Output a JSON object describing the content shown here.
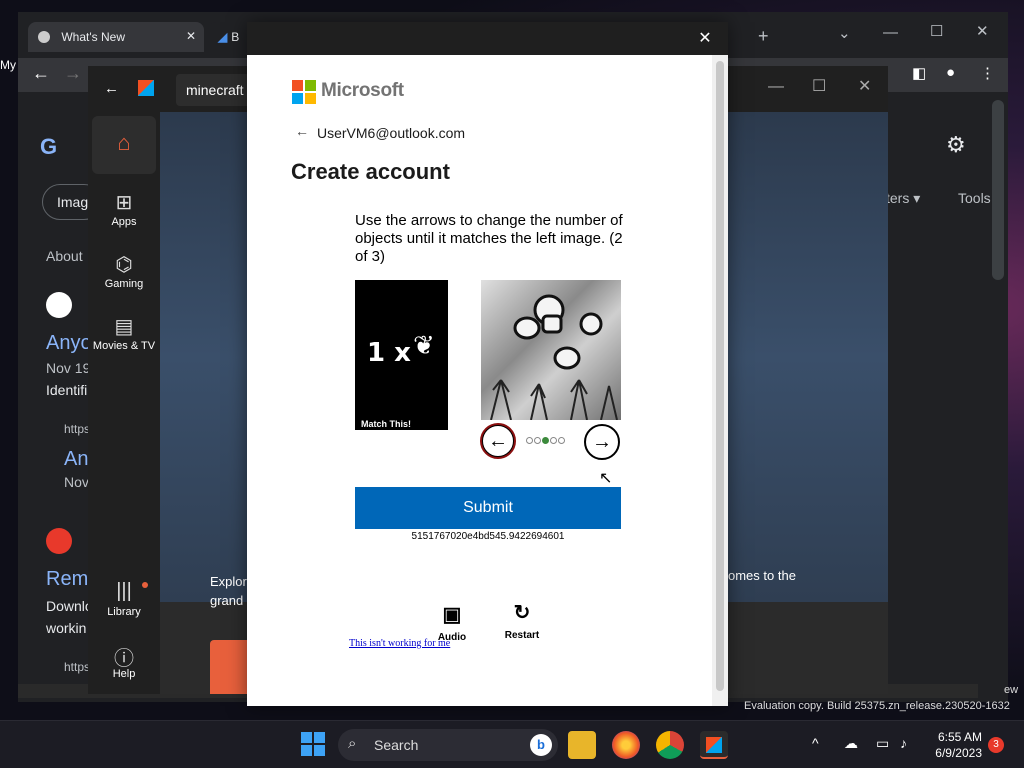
{
  "chrome": {
    "tab1": "What's New",
    "tab2": "B",
    "left_clip": "My"
  },
  "store": {
    "search_value": "minecraft",
    "rail": [
      {
        "label": "Apps"
      },
      {
        "label": "Gaming"
      },
      {
        "label": "Movies & TV"
      },
      {
        "label": "Library"
      },
      {
        "label": "Help"
      }
    ],
    "bottom_text_1": "Explor",
    "bottom_text_2": "grand",
    "bottom_text_right": "omes to the"
  },
  "google": {
    "imag": "Imag",
    "about": "About",
    "anyo": "Anyo",
    "nov19": "Nov 19",
    "identifi": "Identifi",
    "https1": "https",
    "an": "An",
    "nov": "Nov",
    "remo": "Remo",
    "downlo": "Downlo",
    "workin": "workin",
    "https2": "https",
    "ters": "ters",
    "tools": "Tools",
    "ew": "ew"
  },
  "dialog": {
    "brand": "Microsoft",
    "email": "UserVM6@outlook.com",
    "title": "Create account",
    "instructions": "Use the arrows to change the number of objects until it matches the left image. (2 of 3)",
    "match_label": "Match This!",
    "match_text": "1 x",
    "submit_label": "Submit",
    "challenge_id": "5151767020e4bd545.9422694601",
    "audio_label": "Audio",
    "restart_label": "Restart",
    "not_working_label": "This isn't working for me",
    "progress": {
      "total": 5,
      "current": 3
    }
  },
  "taskbar": {
    "search_placeholder": "Search",
    "time": "6:55 AM",
    "date": "6/9/2023",
    "badge": "3"
  },
  "eval_text": "Evaluation copy. Build 25375.zn_release.230520-1632",
  "colors": {
    "submit_blue": "#0067b8",
    "ms_red": "#f25022",
    "ms_green": "#7fba00",
    "ms_blue": "#00a4ef",
    "ms_yellow": "#ffb900"
  }
}
